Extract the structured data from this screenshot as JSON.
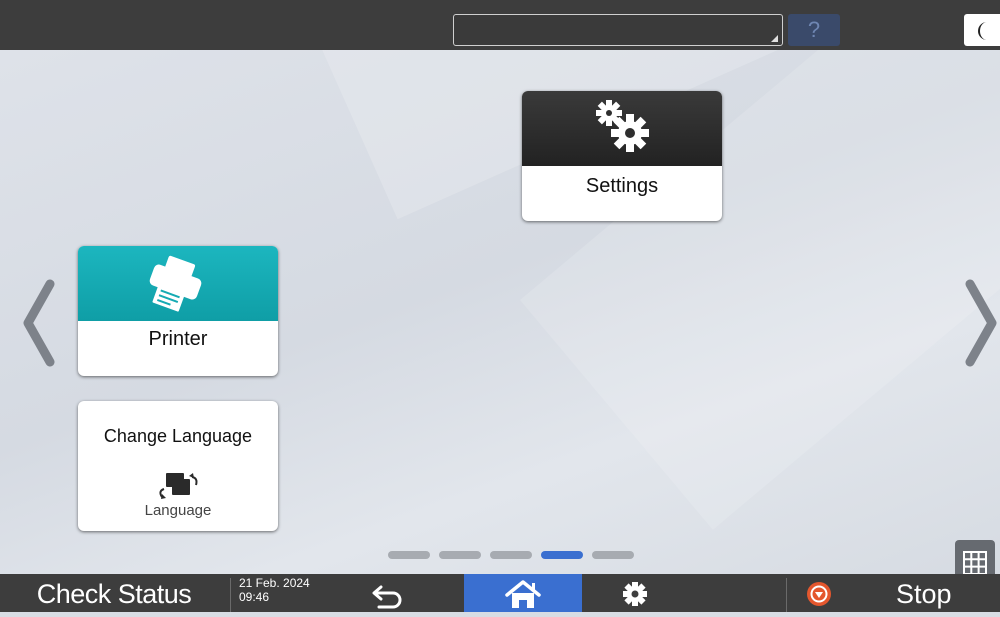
{
  "header": {
    "message_box_text": "",
    "help_label": "?",
    "sleep_icon": "crescent-moon-icon"
  },
  "home": {
    "tiles": {
      "settings": {
        "label": "Settings",
        "icon": "gears-icon",
        "color": "#2e2e2e"
      },
      "printer": {
        "label": "Printer",
        "icon": "printer-icon",
        "color": "#15aab3"
      },
      "change_language": {
        "label": "Change Language",
        "sublabel": "Language",
        "icon": "language-switch-icon"
      }
    },
    "page_count": 5,
    "current_page": 4,
    "active_dot_color": "#3a6fd0"
  },
  "footer": {
    "check_status": "Check Status",
    "date": "21 Feb. 2024",
    "time": "09:46",
    "stop_label": "Stop",
    "home_color": "#3a6fd0",
    "stop_icon_color": "#e4572e"
  }
}
